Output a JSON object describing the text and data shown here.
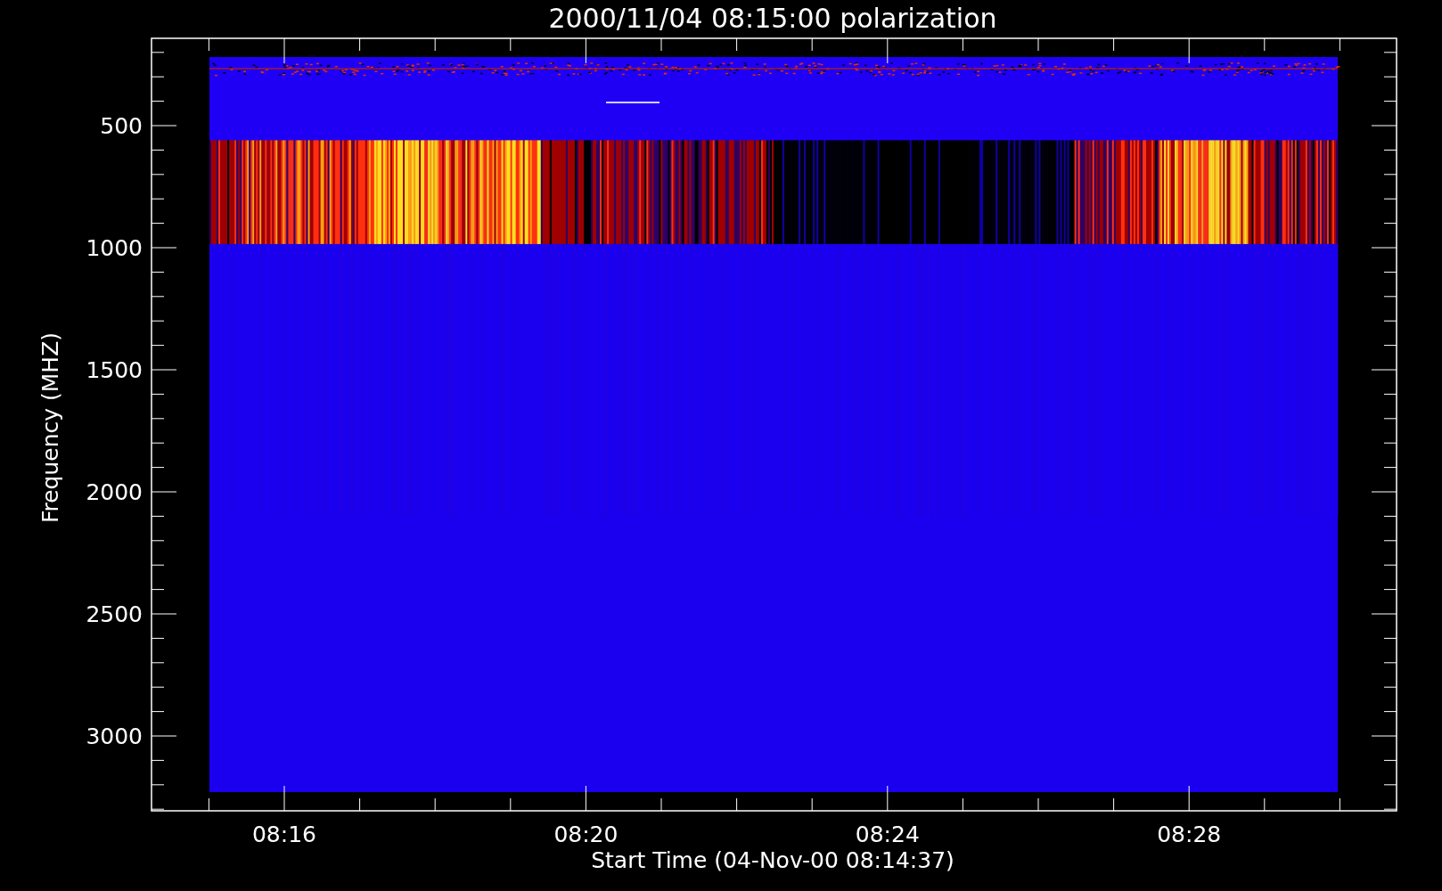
{
  "plot": {
    "title": "2000/11/04 08:15:00 polarization",
    "y_axis": {
      "label": "Frequency (MHZ)",
      "ticks": [
        "500",
        "1000",
        "1500",
        "2000",
        "2500",
        "3000"
      ]
    },
    "x_axis": {
      "label": "Start Time (04-Nov-00 08:14:37)",
      "ticks": [
        "08:16",
        "08:20",
        "08:24",
        "08:28"
      ]
    }
  }
}
